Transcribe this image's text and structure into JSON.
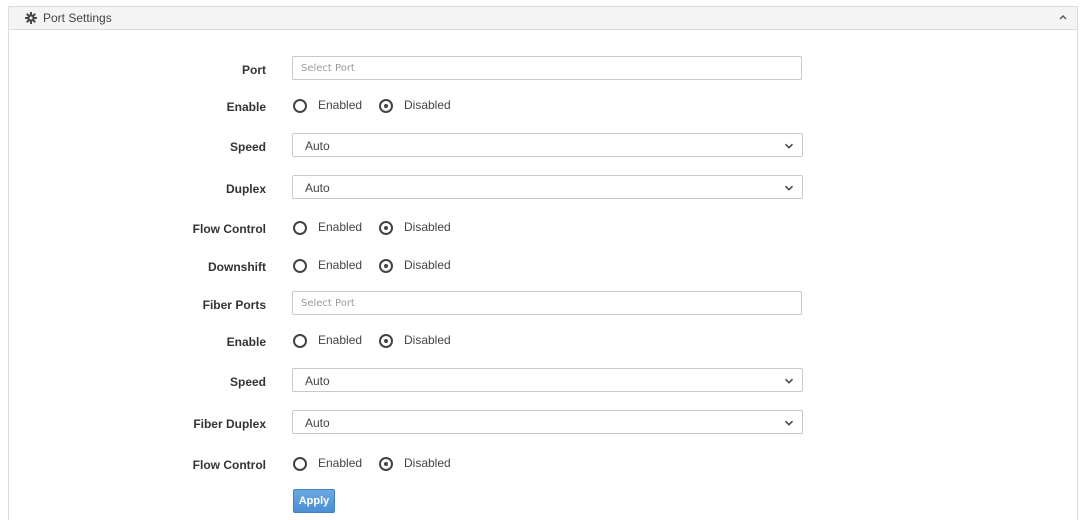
{
  "panel": {
    "title": "Port Settings",
    "header_icon": "gear-icon",
    "collapse_icon": "chevron-up-icon"
  },
  "radio_labels": {
    "enabled": "Enabled",
    "disabled": "Disabled"
  },
  "form": {
    "port": {
      "label": "Port",
      "placeholder": "Select Port",
      "value": ""
    },
    "enable": {
      "label": "Enable",
      "selected": "Disabled"
    },
    "speed": {
      "label": "Speed",
      "value": "Auto"
    },
    "duplex": {
      "label": "Duplex",
      "value": "Auto"
    },
    "flow_control": {
      "label": "Flow Control",
      "selected": "Disabled"
    },
    "downshift": {
      "label": "Downshift",
      "selected": "Disabled"
    },
    "fiber_ports": {
      "label": "Fiber Ports",
      "placeholder": "Select Port",
      "value": ""
    },
    "fiber_enable": {
      "label": "Enable",
      "selected": "Disabled"
    },
    "fiber_speed": {
      "label": "Speed",
      "value": "Auto"
    },
    "fiber_duplex": {
      "label": "Fiber Duplex",
      "value": "Auto"
    },
    "fiber_flow_control": {
      "label": "Flow Control",
      "selected": "Disabled"
    }
  },
  "apply_label": "Apply",
  "colors": {
    "accent": "#4b8ed2",
    "header_bg": "#f4f4f4",
    "border": "#c9c9c9"
  }
}
